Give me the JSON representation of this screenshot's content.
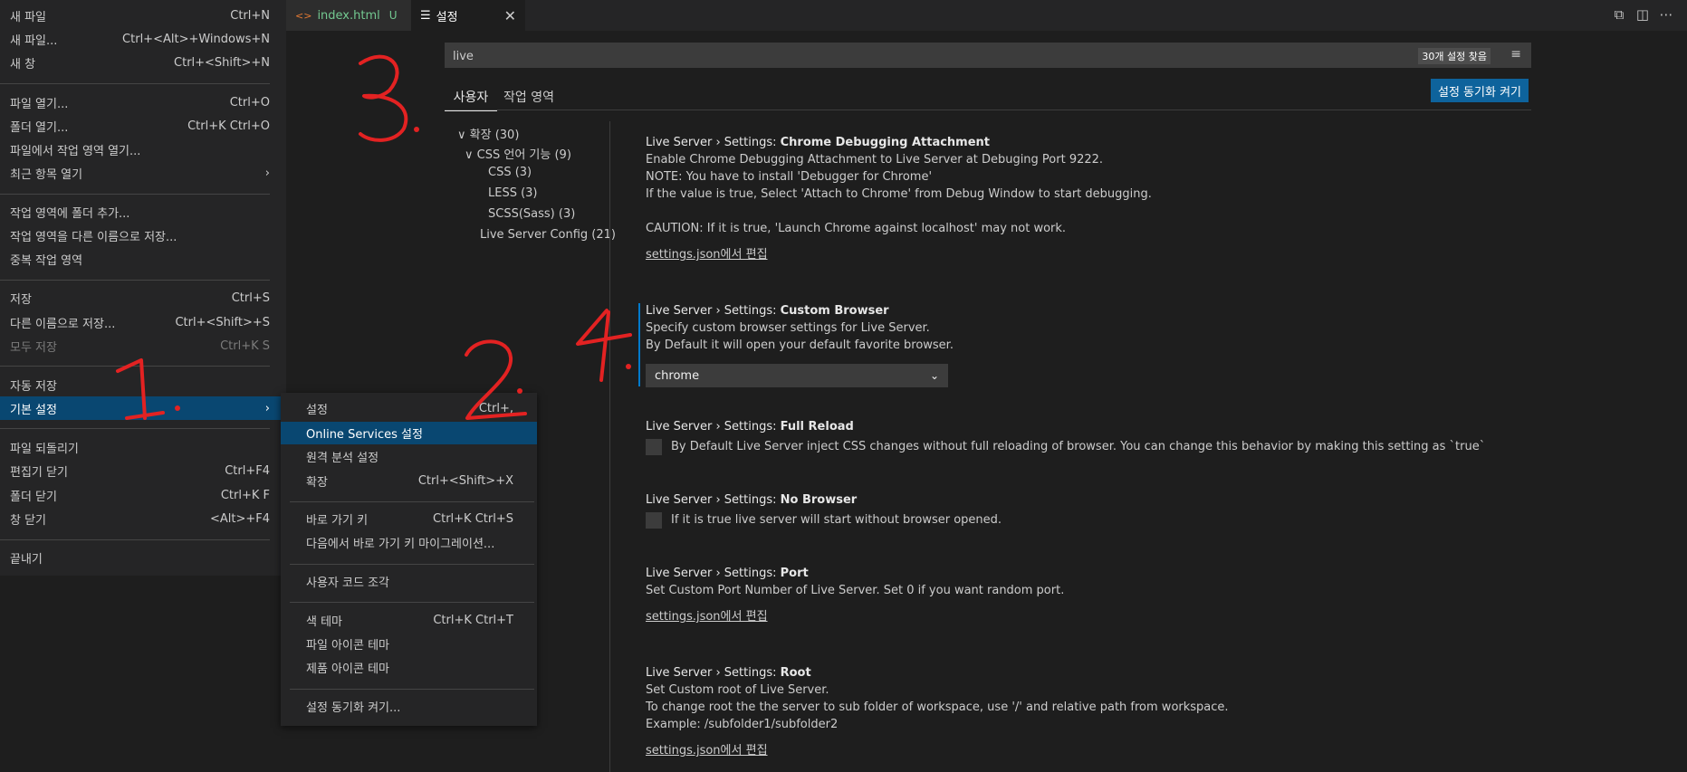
{
  "tabs": {
    "index_label": "index.html",
    "index_badge": "U",
    "settings_label": "설정",
    "close_glyph": "✕"
  },
  "main_menu": [
    {
      "label": "새 파일",
      "key": "Ctrl+N"
    },
    {
      "label": "새 파일...",
      "key": "Ctrl+<Alt>+Windows+N"
    },
    {
      "label": "새 창",
      "key": "Ctrl+<Shift>+N"
    },
    {
      "label": "파일 열기...",
      "key": "Ctrl+O"
    },
    {
      "label": "폴더 열기...",
      "key": "Ctrl+K Ctrl+O"
    },
    {
      "label": "파일에서 작업 영역 열기...",
      "key": ""
    },
    {
      "label": "최근 항목 열기",
      "key": "›"
    },
    {
      "label": "작업 영역에 폴더 추가...",
      "key": ""
    },
    {
      "label": "작업 영역을 다른 이름으로 저장...",
      "key": ""
    },
    {
      "label": "중복 작업 영역",
      "key": ""
    },
    {
      "label": "저장",
      "key": "Ctrl+S"
    },
    {
      "label": "다른 이름으로 저장...",
      "key": "Ctrl+<Shift>+S"
    },
    {
      "label": "모두 저장",
      "key": "Ctrl+K S"
    },
    {
      "label": "자동 저장",
      "key": ""
    },
    {
      "label": "기본 설정",
      "key": "›"
    },
    {
      "label": "파일 되돌리기",
      "key": ""
    },
    {
      "label": "편집기 닫기",
      "key": "Ctrl+F4"
    },
    {
      "label": "폴더 닫기",
      "key": "Ctrl+K F"
    },
    {
      "label": "창 닫기",
      "key": "<Alt>+F4"
    },
    {
      "label": "끝내기",
      "key": ""
    }
  ],
  "sub_menu": [
    {
      "label": "설정",
      "key": "Ctrl+,"
    },
    {
      "label": "Online Services 설정",
      "key": ""
    },
    {
      "label": "원격 분석 설정",
      "key": ""
    },
    {
      "label": "확장",
      "key": "Ctrl+<Shift>+X"
    },
    {
      "label": "바로 가기 키",
      "key": "Ctrl+K Ctrl+S"
    },
    {
      "label": "다음에서 바로 가기 키 마이그레이션...",
      "key": ""
    },
    {
      "label": "사용자 코드 조각",
      "key": ""
    },
    {
      "label": "색 테마",
      "key": "Ctrl+K Ctrl+T"
    },
    {
      "label": "파일 아이콘 테마",
      "key": ""
    },
    {
      "label": "제품 아이콘 테마",
      "key": ""
    },
    {
      "label": "설정 동기화 켜기...",
      "key": ""
    }
  ],
  "settings": {
    "search_value": "live",
    "result_count": "30개 설정 찾음",
    "tab_user": "사용자",
    "tab_workspace": "작업 영역",
    "sync_button": "설정 동기화 켜기",
    "toc": [
      {
        "label": "확장 (30)",
        "glyph": "∨"
      },
      {
        "label": "CSS 언어 기능 (9)",
        "glyph": "∨"
      },
      {
        "label": "CSS (3)"
      },
      {
        "label": "LESS (3)"
      },
      {
        "label": "SCSS(Sass) (3)"
      },
      {
        "label": "Live Server Config (21)"
      }
    ],
    "prefix": "Live Server › Settings: ",
    "items": [
      {
        "name": "Chrome Debugging Attachment",
        "desc": "Enable Chrome Debugging Attachment to Live Server at Debuging Port 9222.\nNOTE: You have to install 'Debugger for Chrome'\nIf the value is true, Select 'Attach to Chrome' from Debug Window to start debugging.\n\nCAUTION: If it is true, 'Launch Chrome against localhost' may not work.",
        "link": "settings.json에서 편집"
      },
      {
        "name": "Custom Browser",
        "desc": "Specify custom browser settings for Live Server.\nBy Default it will open your default favorite browser.",
        "select_value": "chrome"
      },
      {
        "name": "Full Reload",
        "check_label": "By Default Live Server inject CSS changes without full reloading of browser. You can change this behavior by making this setting as `true`"
      },
      {
        "name": "No Browser",
        "check_label": "If it is true live server will start without browser opened."
      },
      {
        "name": "Port",
        "desc": "Set Custom Port Number of Live Server. Set 0 if you want random port.",
        "link": "settings.json에서 편집"
      },
      {
        "name": "Root",
        "desc": "Set Custom root of Live Server.\nTo change root the the server to sub folder of workspace, use '/' and relative path from workspace.\nExample: /subfolder1/subfolder2",
        "link": "settings.json에서 편집"
      }
    ]
  },
  "colors": {
    "accent": "#007acc",
    "highlight": "#094771",
    "button": "#0e639c",
    "annotation": "#e32222"
  },
  "icons": [
    "html-file-icon",
    "settings-file-icon",
    "close-icon",
    "open-changes-icon",
    "split-editor-icon",
    "more-actions-icon",
    "filter-icon",
    "chevron-right-icon",
    "chevron-down-icon"
  ]
}
